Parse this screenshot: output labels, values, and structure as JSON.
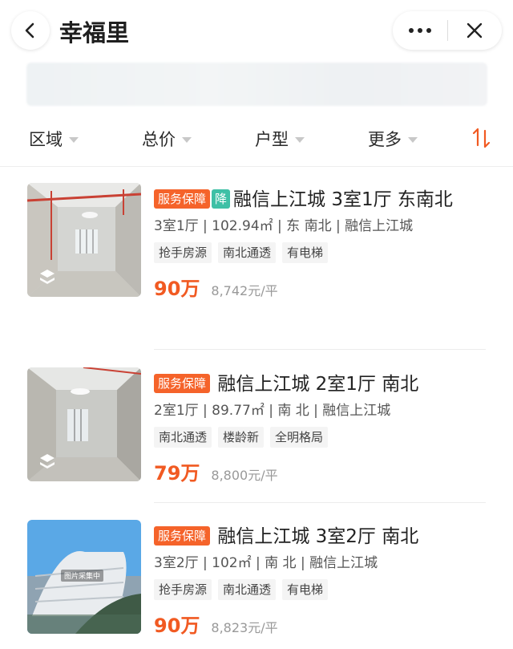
{
  "header": {
    "title": "幸福里",
    "back_icon": "back-arrow-icon",
    "more_icon": "more-dots-icon",
    "close_icon": "close-icon"
  },
  "filters": [
    {
      "label": "区域"
    },
    {
      "label": "总价"
    },
    {
      "label": "户型"
    },
    {
      "label": "更多"
    }
  ],
  "sort_icon": "sort-icon",
  "colors": {
    "accent": "#f15a22",
    "badge": "#f5632a",
    "badge_drop": "#3fc0a6",
    "tag_bg": "#f4f4f4"
  },
  "listings": [
    {
      "badge": "服务保障",
      "drop_badge": "降",
      "title": "融信上江城 3室1厅 东南北",
      "specs": "3室1厅 | 102.94㎡ | 东 南北 | 融信上江城",
      "tags": [
        "抢手房源",
        "南北通透",
        "有电梯"
      ],
      "price": "90万",
      "unit_price": "8,742元/平"
    },
    {
      "badge": "服务保障",
      "title": "融信上江城 2室1厅 南北",
      "specs": "2室1厅 | 89.77㎡ | 南 北 | 融信上江城",
      "tags": [
        "南北通透",
        "楼龄新",
        "全明格局"
      ],
      "price": "79万",
      "unit_price": "8,800元/平"
    },
    {
      "badge": "服务保障",
      "title": "融信上江城 3室2厅 南北",
      "specs": "3室2厅 | 102㎡ | 南 北 | 融信上江城",
      "tags": [
        "抢手房源",
        "南北通透",
        "有电梯"
      ],
      "price": "90万",
      "unit_price": "8,823元/平",
      "image_caption": "图片采集中"
    }
  ]
}
